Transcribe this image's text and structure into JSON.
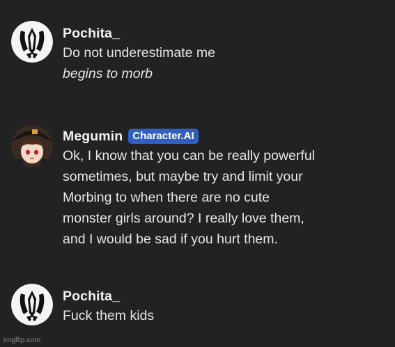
{
  "messages": [
    {
      "author": "Pochita_",
      "avatar_icon": "pochita-avatar-icon",
      "lines": [
        "Do not underestimate me",
        "begins to morb"
      ],
      "italic_line_index": 1
    },
    {
      "author": "Megumin",
      "badge": "Character.AI",
      "avatar_icon": "megumin-avatar-icon",
      "lines": [
        "Ok, I know that you can be really powerful",
        "sometimes, but maybe try and limit your",
        "Morbing to when there are no cute",
        "monster girls around?  I really love them,",
        "and I would be sad if you hurt them."
      ]
    },
    {
      "author": "Pochita_",
      "avatar_icon": "pochita-avatar-icon",
      "lines": [
        "Fuck them kids"
      ]
    }
  ],
  "watermark": "imgflip.com",
  "colors": {
    "background": "#222222",
    "text": "#e6e6e6",
    "badge": "#2f5fc2"
  }
}
